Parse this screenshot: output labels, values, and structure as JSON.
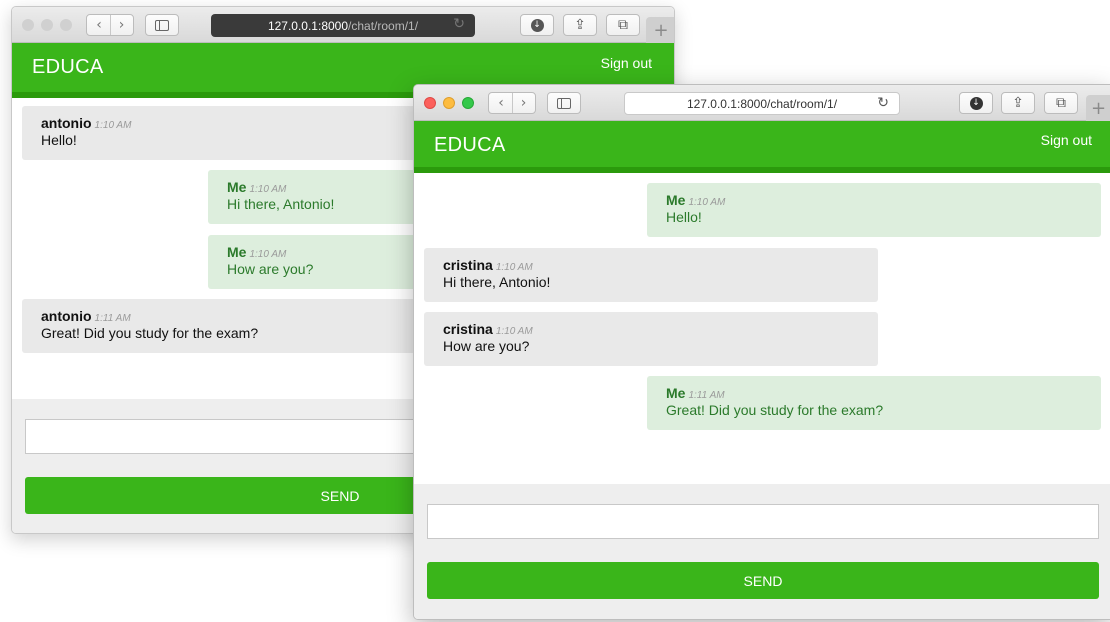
{
  "colors": {
    "accent": "#3ab51a",
    "accent_dark": "#2b9a0c",
    "my_message_bg": "#ddeedd",
    "my_message_text": "#2b7a2b",
    "other_message_bg": "#e9e9e9",
    "footer_bg": "#eeeeee"
  },
  "back_window": {
    "url_host": "127.0.0.1:8000",
    "url_path": "/chat/room/1/",
    "brand": "EDUCA",
    "signout_label": "Sign out",
    "messages": [
      {
        "author": "antonio",
        "time": "1:10 AM",
        "text": "Hello!",
        "mine": false
      },
      {
        "author": "Me",
        "time": "1:10 AM",
        "text": "Hi there, Antonio!",
        "mine": true
      },
      {
        "author": "Me",
        "time": "1:10 AM",
        "text": "How are you?",
        "mine": true
      },
      {
        "author": "antonio",
        "time": "1:11 AM",
        "text": "Great! Did you study for the exam?",
        "mine": false
      }
    ],
    "input_value": "",
    "send_label": "SEND"
  },
  "front_window": {
    "url": "127.0.0.1:8000/chat/room/1/",
    "brand": "EDUCA",
    "signout_label": "Sign out",
    "messages": [
      {
        "author": "Me",
        "time": "1:10 AM",
        "text": "Hello!",
        "mine": true
      },
      {
        "author": "cristina",
        "time": "1:10 AM",
        "text": "Hi there, Antonio!",
        "mine": false
      },
      {
        "author": "cristina",
        "time": "1:10 AM",
        "text": "How are you?",
        "mine": false
      },
      {
        "author": "Me",
        "time": "1:11 AM",
        "text": "Great! Did you study for the exam?",
        "mine": true
      }
    ],
    "input_value": "",
    "send_label": "SEND"
  },
  "browser": {
    "back_icon": "chevron-left-icon",
    "forward_icon": "chevron-right-icon",
    "sidebar_icon": "sidebar-icon",
    "reload_icon": "reload-icon",
    "download_icon": "download-icon",
    "share_icon": "share-icon",
    "tabs_icon": "tabs-icon",
    "new_tab_icon": "plus-icon"
  }
}
